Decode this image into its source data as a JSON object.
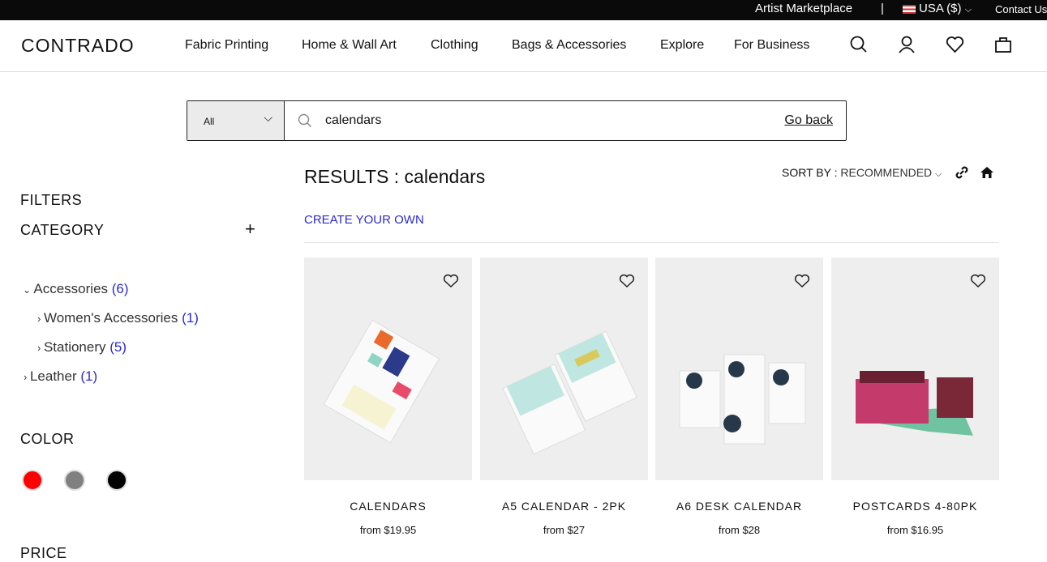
{
  "topbar": {
    "artist": "Artist Marketplace",
    "divider": "|",
    "currency": "USA ($)",
    "contact": "Contact Us"
  },
  "nav": {
    "logo": "CONTRADO",
    "items": [
      "Fabric Printing",
      "Home & Wall Art",
      "Clothing",
      "Bags & Accessories",
      "Explore",
      "For Business"
    ]
  },
  "search": {
    "category": "All",
    "query": "calendars",
    "go_back": "Go back"
  },
  "filters": {
    "title": "FILTERS",
    "category": "CATEGORY",
    "tree": [
      {
        "label": "Accessories",
        "count": "(6)"
      },
      {
        "label": "Women's Accessories",
        "count": "(1)"
      },
      {
        "label": "Stationery",
        "count": "(5)"
      },
      {
        "label": "Leather",
        "count": "(1)"
      }
    ],
    "color": "COLOR",
    "colors": [
      "#ff0000",
      "#808080",
      "#000000"
    ],
    "price": "PRICE"
  },
  "results": {
    "title": "RESULTS : calendars",
    "create": "CREATE YOUR OWN",
    "sort_label": "SORT BY :",
    "sort_value": "RECOMMENDED"
  },
  "products": [
    {
      "name": "CALENDARS",
      "price": "from $19.95"
    },
    {
      "name": "A5 CALENDAR - 2PK",
      "price": "from $27"
    },
    {
      "name": "A6 DESK CALENDAR",
      "price": "from $28"
    },
    {
      "name": "POSTCARDS 4-80PK",
      "price": "from $16.95"
    }
  ]
}
